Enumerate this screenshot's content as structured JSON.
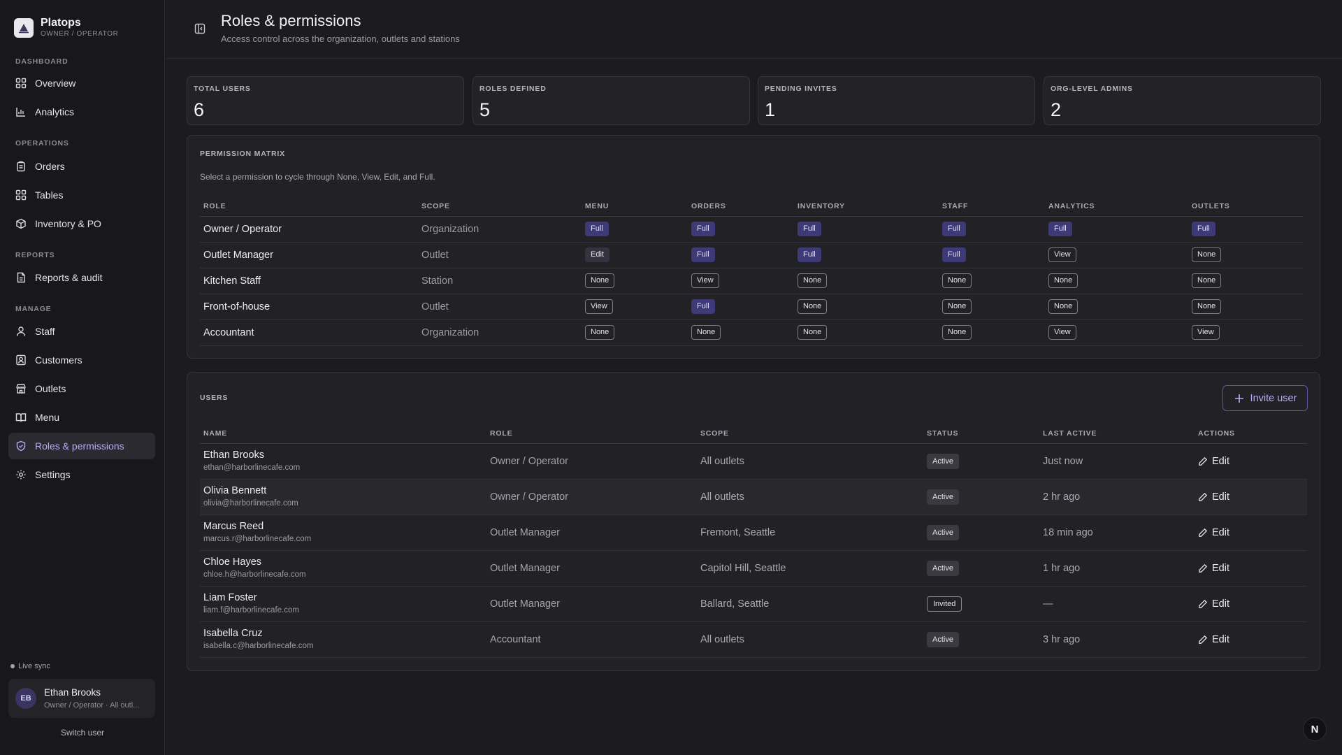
{
  "brand": {
    "name": "Platops",
    "subtitle": "OWNER / OPERATOR"
  },
  "sidebar": {
    "sections": [
      {
        "label": "DASHBOARD",
        "items": [
          {
            "label": "Overview",
            "icon": "grid-icon"
          },
          {
            "label": "Analytics",
            "icon": "bar-chart-icon"
          }
        ]
      },
      {
        "label": "OPERATIONS",
        "items": [
          {
            "label": "Orders",
            "icon": "clipboard-icon"
          },
          {
            "label": "Tables",
            "icon": "grid-icon"
          },
          {
            "label": "Inventory & PO",
            "icon": "package-icon"
          }
        ]
      },
      {
        "label": "REPORTS",
        "items": [
          {
            "label": "Reports & audit",
            "icon": "file-icon"
          }
        ]
      },
      {
        "label": "MANAGE",
        "items": [
          {
            "label": "Staff",
            "icon": "user-icon"
          },
          {
            "label": "Customers",
            "icon": "contact-icon"
          },
          {
            "label": "Outlets",
            "icon": "store-icon"
          },
          {
            "label": "Menu",
            "icon": "book-icon"
          },
          {
            "label": "Roles & permissions",
            "icon": "shield-icon",
            "active": true
          },
          {
            "label": "Settings",
            "icon": "gear-icon"
          }
        ]
      }
    ],
    "live_sync": "Live sync",
    "user": {
      "initials": "EB",
      "name": "Ethan Brooks",
      "role": "Owner / Operator · All outl..."
    },
    "switch_user": "Switch user"
  },
  "header": {
    "title": "Roles & permissions",
    "subtitle": "Access control across the organization, outlets and stations"
  },
  "stats": [
    {
      "label": "TOTAL USERS",
      "value": "6"
    },
    {
      "label": "ROLES DEFINED",
      "value": "5"
    },
    {
      "label": "PENDING INVITES",
      "value": "1"
    },
    {
      "label": "ORG-LEVEL ADMINS",
      "value": "2"
    }
  ],
  "matrix": {
    "title": "PERMISSION MATRIX",
    "description": "Select a permission to cycle through None, View, Edit, and Full.",
    "columns": [
      "ROLE",
      "SCOPE",
      "MENU",
      "ORDERS",
      "INVENTORY",
      "STAFF",
      "ANALYTICS",
      "OUTLETS"
    ],
    "rows": [
      {
        "role": "Owner / Operator",
        "scope": "Organization",
        "perms": [
          "Full",
          "Full",
          "Full",
          "Full",
          "Full",
          "Full"
        ]
      },
      {
        "role": "Outlet Manager",
        "scope": "Outlet",
        "perms": [
          "Edit",
          "Full",
          "Full",
          "Full",
          "View",
          "None"
        ]
      },
      {
        "role": "Kitchen Staff",
        "scope": "Station",
        "perms": [
          "None",
          "View",
          "None",
          "None",
          "None",
          "None"
        ]
      },
      {
        "role": "Front-of-house",
        "scope": "Outlet",
        "perms": [
          "View",
          "Full",
          "None",
          "None",
          "None",
          "None"
        ]
      },
      {
        "role": "Accountant",
        "scope": "Organization",
        "perms": [
          "None",
          "None",
          "None",
          "None",
          "View",
          "View"
        ]
      }
    ]
  },
  "users": {
    "title": "USERS",
    "invite_label": "Invite user",
    "columns": [
      "NAME",
      "ROLE",
      "SCOPE",
      "STATUS",
      "LAST ACTIVE",
      "ACTIONS"
    ],
    "edit_label": "Edit",
    "rows": [
      {
        "name": "Ethan Brooks",
        "email": "ethan@harborlinecafe.com",
        "role": "Owner / Operator",
        "scope": "All outlets",
        "status": "Active",
        "last_active": "Just now"
      },
      {
        "name": "Olivia Bennett",
        "email": "olivia@harborlinecafe.com",
        "role": "Owner / Operator",
        "scope": "All outlets",
        "status": "Active",
        "last_active": "2 hr ago"
      },
      {
        "name": "Marcus Reed",
        "email": "marcus.r@harborlinecafe.com",
        "role": "Outlet Manager",
        "scope": "Fremont, Seattle",
        "status": "Active",
        "last_active": "18 min ago"
      },
      {
        "name": "Chloe Hayes",
        "email": "chloe.h@harborlinecafe.com",
        "role": "Outlet Manager",
        "scope": "Capitol Hill, Seattle",
        "status": "Active",
        "last_active": "1 hr ago"
      },
      {
        "name": "Liam Foster",
        "email": "liam.f@harborlinecafe.com",
        "role": "Outlet Manager",
        "scope": "Ballard, Seattle",
        "status": "Invited",
        "last_active": "—"
      },
      {
        "name": "Isabella Cruz",
        "email": "isabella.c@harborlinecafe.com",
        "role": "Accountant",
        "scope": "All outlets",
        "status": "Active",
        "last_active": "3 hr ago"
      }
    ]
  },
  "corner_badge": "N",
  "colors": {
    "accent": "#3e3a78",
    "accent_text": "#b8adf2",
    "background": "#1c1c1f"
  }
}
